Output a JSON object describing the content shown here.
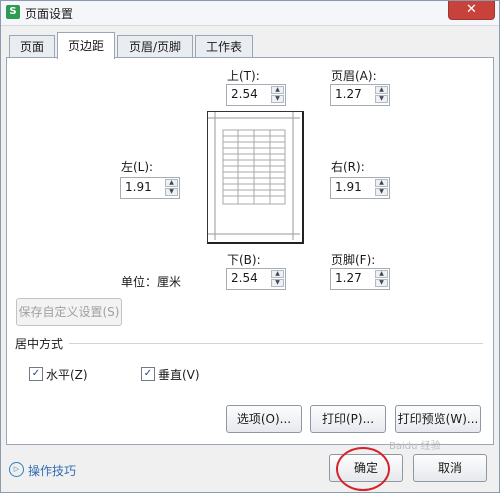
{
  "window": {
    "title": "页面设置",
    "app_icon_letter": "S",
    "close_glyph": "✕"
  },
  "tabs": [
    {
      "label": "页面",
      "active": false
    },
    {
      "label": "页边距",
      "active": true
    },
    {
      "label": "页眉/页脚",
      "active": false
    },
    {
      "label": "工作表",
      "active": false
    }
  ],
  "margins": {
    "top": {
      "label": "上(T):",
      "value": "2.54"
    },
    "header": {
      "label": "页眉(A):",
      "value": "1.27"
    },
    "left": {
      "label": "左(L):",
      "value": "1.91"
    },
    "right": {
      "label": "右(R):",
      "value": "1.91"
    },
    "bottom": {
      "label": "下(B):",
      "value": "2.54"
    },
    "footer": {
      "label": "页脚(F):",
      "value": "1.27"
    }
  },
  "unit": {
    "label": "单位：厘米"
  },
  "save_custom_button": {
    "label": "保存自定义设置(S)",
    "enabled": false
  },
  "centering": {
    "title": "居中方式",
    "horizontal": {
      "label": "水平(Z)",
      "checked": true
    },
    "vertical": {
      "label": "垂直(V)",
      "checked": true
    }
  },
  "actions": {
    "options": "选项(O)...",
    "print": "打印(P)...",
    "print_preview": "打印预览(W)..."
  },
  "footer": {
    "tips_link": "操作技巧",
    "ok": "确定",
    "cancel": "取消"
  },
  "check_glyph": "✓",
  "spin_up_glyph": "▲",
  "spin_down_glyph": "▼",
  "tips_icon_glyph": "▷",
  "watermark": "Baidu 经验"
}
